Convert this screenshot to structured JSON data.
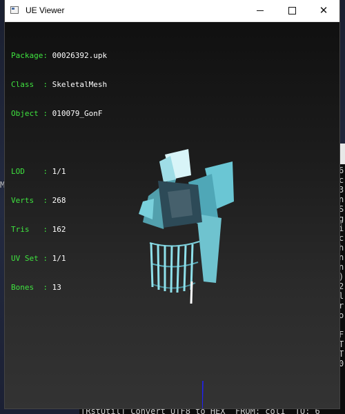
{
  "window": {
    "title": "UE Viewer",
    "controls": {
      "minimize": "minimize",
      "maximize": "maximize",
      "close": "close"
    }
  },
  "info": {
    "package_key": "Package:",
    "package_value": "00026392.upk",
    "class_key": "Class  :",
    "class_value": "SkeletalMesh",
    "object_key": "Object :",
    "object_value": "010079_GonF",
    "lod_key": "LOD    :",
    "lod_value": "1/1",
    "verts_key": "Verts  :",
    "verts_value": "268",
    "tris_key": "Tris   :",
    "tris_value": "162",
    "uvset_key": "UV Set :",
    "uvset_value": "1/1",
    "bones_key": "Bones  :",
    "bones_value": "13"
  },
  "background": {
    "left_char": "M",
    "console_column": "6\nc\n3\nn\nS\ng\ni\nc\nh\nn\nn\n)\n2\nl\nr\no\n\nF\nT\nT\n0",
    "bottom_console": "[RstUtil] Convert UTF8 to HEX  FROM: col1  TO: 6"
  },
  "colors": {
    "info_key": "#3fe43f",
    "info_value": "#ffffff",
    "mesh": "#62c4d2"
  }
}
